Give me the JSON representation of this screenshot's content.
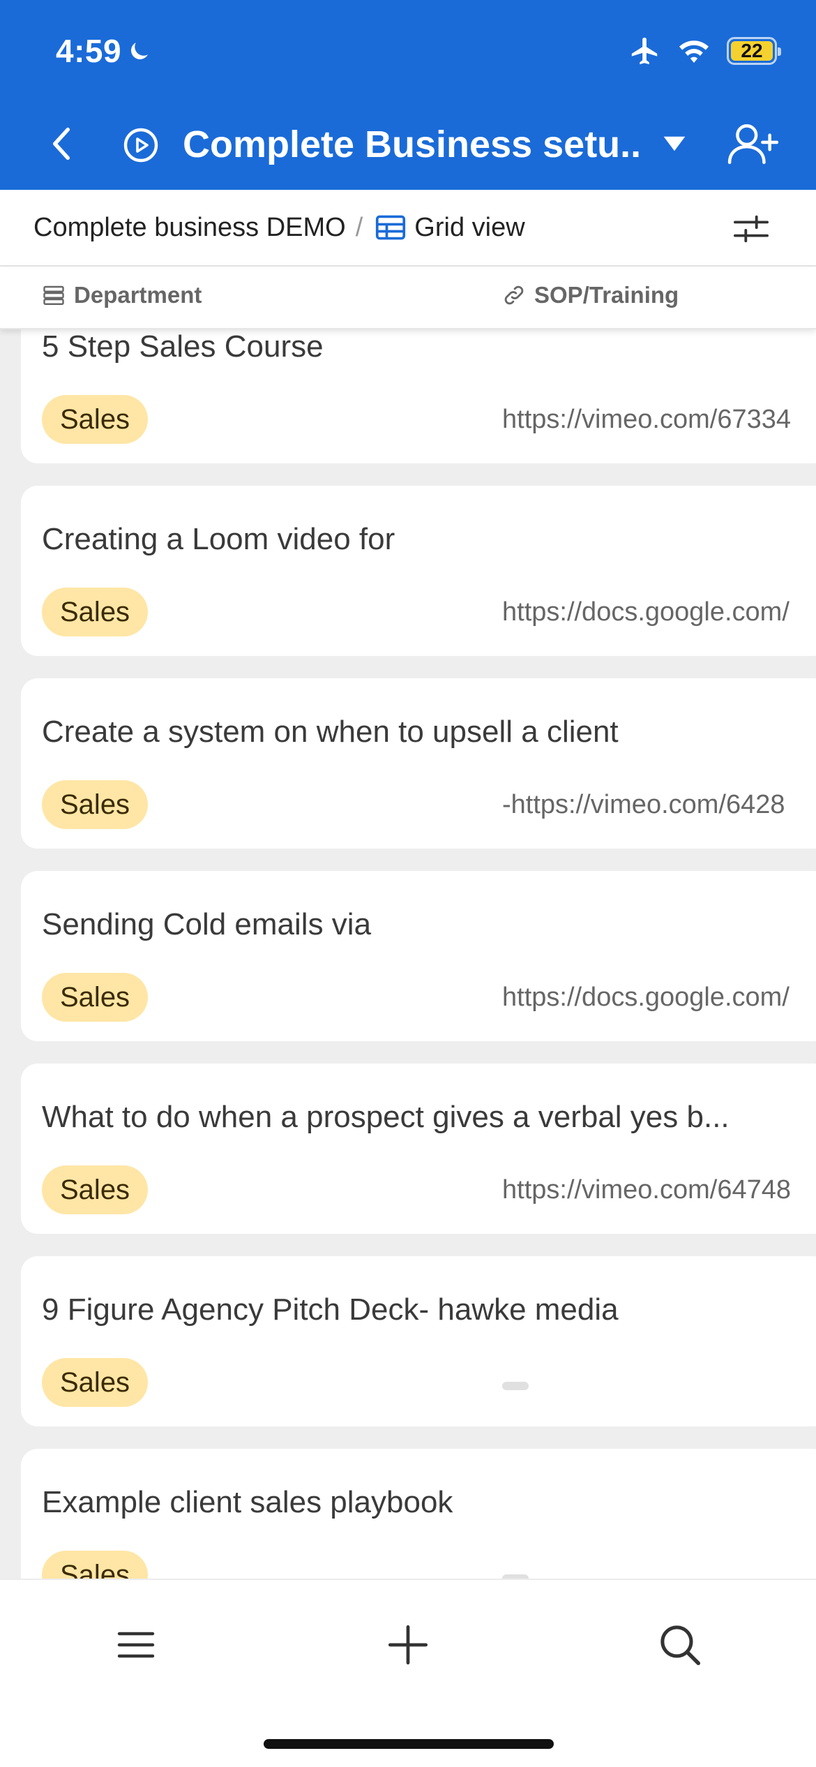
{
  "status_bar": {
    "time": "4:59",
    "battery": "22",
    "icons": [
      "moon-icon",
      "airplane-icon",
      "wifi-icon",
      "battery-icon"
    ]
  },
  "header": {
    "title": "Complete Business setu...",
    "icons": [
      "back-icon",
      "play-circle-icon",
      "caret-down-icon",
      "add-user-icon"
    ],
    "background_color": "#1a6bd8"
  },
  "breadcrumb": {
    "base": "Complete business DEMO",
    "separator": "/",
    "view": "Grid view",
    "icons": [
      "grid-icon",
      "filter-icon"
    ]
  },
  "columns": {
    "department": "Department",
    "sop_training": "SOP/Training",
    "icons": [
      "list-field-icon",
      "link-field-icon"
    ]
  },
  "records": [
    {
      "title": "5 Step Sales Course",
      "department": "Sales",
      "link": "https://vimeo.com/67334"
    },
    {
      "title": "Creating a Loom video for",
      "department": "Sales",
      "link": "https://docs.google.com/"
    },
    {
      "title": "Create a system on when to upsell a client",
      "department": "Sales",
      "link": "-https://vimeo.com/6428"
    },
    {
      "title": "Sending Cold emails via",
      "department": "Sales",
      "link": "https://docs.google.com/"
    },
    {
      "title": "What to do when a prospect gives a verbal yes b...",
      "department": "Sales",
      "link": "https://vimeo.com/64748"
    },
    {
      "title": "9 Figure Agency Pitch Deck- hawke media",
      "department": "Sales",
      "link": ""
    },
    {
      "title": "Example client sales playbook",
      "department": "Sales",
      "link": ""
    }
  ],
  "bottom_bar": {
    "icons": [
      "menu-icon",
      "plus-icon",
      "search-icon"
    ]
  },
  "colors": {
    "tag_background": "#ffe6a6",
    "page_background": "#eeeeee"
  }
}
